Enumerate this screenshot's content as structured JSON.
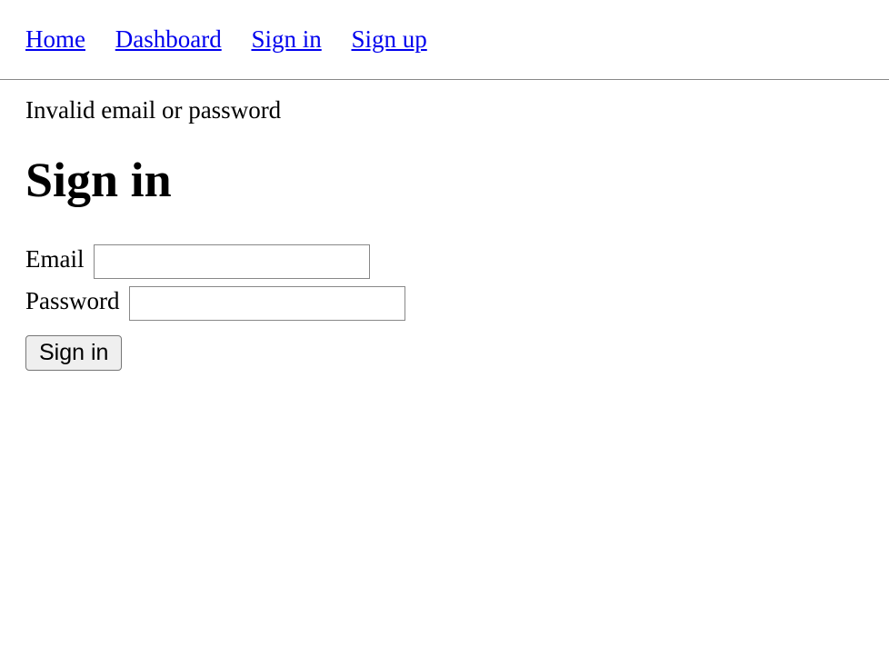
{
  "nav": {
    "home": "Home",
    "dashboard": "Dashboard",
    "signin": "Sign in",
    "signup": "Sign up"
  },
  "error_message": "Invalid email or password",
  "page_title": "Sign in",
  "form": {
    "email_label": "Email",
    "email_value": "",
    "password_label": "Password",
    "password_value": "",
    "submit_label": "Sign in"
  }
}
